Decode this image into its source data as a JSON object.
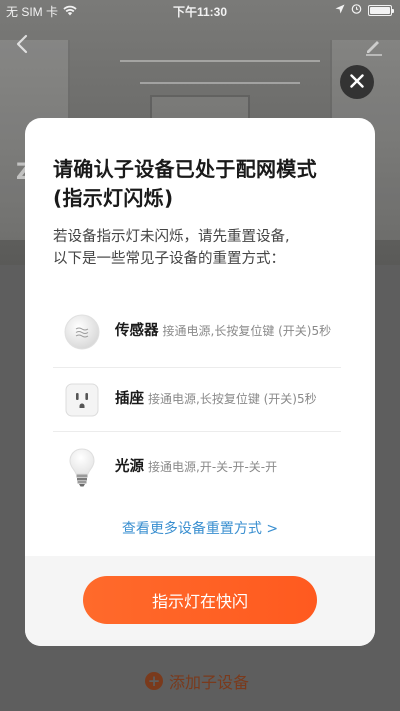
{
  "status_bar": {
    "carrier": "无 SIM 卡",
    "time": "下午11:30",
    "battery_level": 1.0
  },
  "background": {
    "partial_title_char": "Z",
    "partial_line_1": "",
    "partial_line_2": ""
  },
  "modal": {
    "title_line_1": "请确认子设备已处于配网模式",
    "title_line_2": "(指示灯闪烁)",
    "desc_line_1": "若设备指示灯未闪烁，请先重置设备,",
    "desc_line_2": "以下是一些常见子设备的重置方式：",
    "devices": [
      {
        "icon": "sensor-icon",
        "name": "传感器",
        "instruction": "接通电源,长按复位键 (开关)5秒"
      },
      {
        "icon": "socket-icon",
        "name": "插座",
        "instruction": "接通电源,长按复位键 (开关)5秒"
      },
      {
        "icon": "light-bulb-icon",
        "name": "光源",
        "instruction": "接通电源,开-关-开-关-开"
      }
    ],
    "more_link": "查看更多设备重置方式 >",
    "primary_button": "指示灯在快闪"
  },
  "bottom": {
    "add_subdevice_label": "添加子设备"
  },
  "colors": {
    "accent": "#ff5a1f",
    "link": "#3a8fd0",
    "overlay": "#5e5e5e"
  }
}
